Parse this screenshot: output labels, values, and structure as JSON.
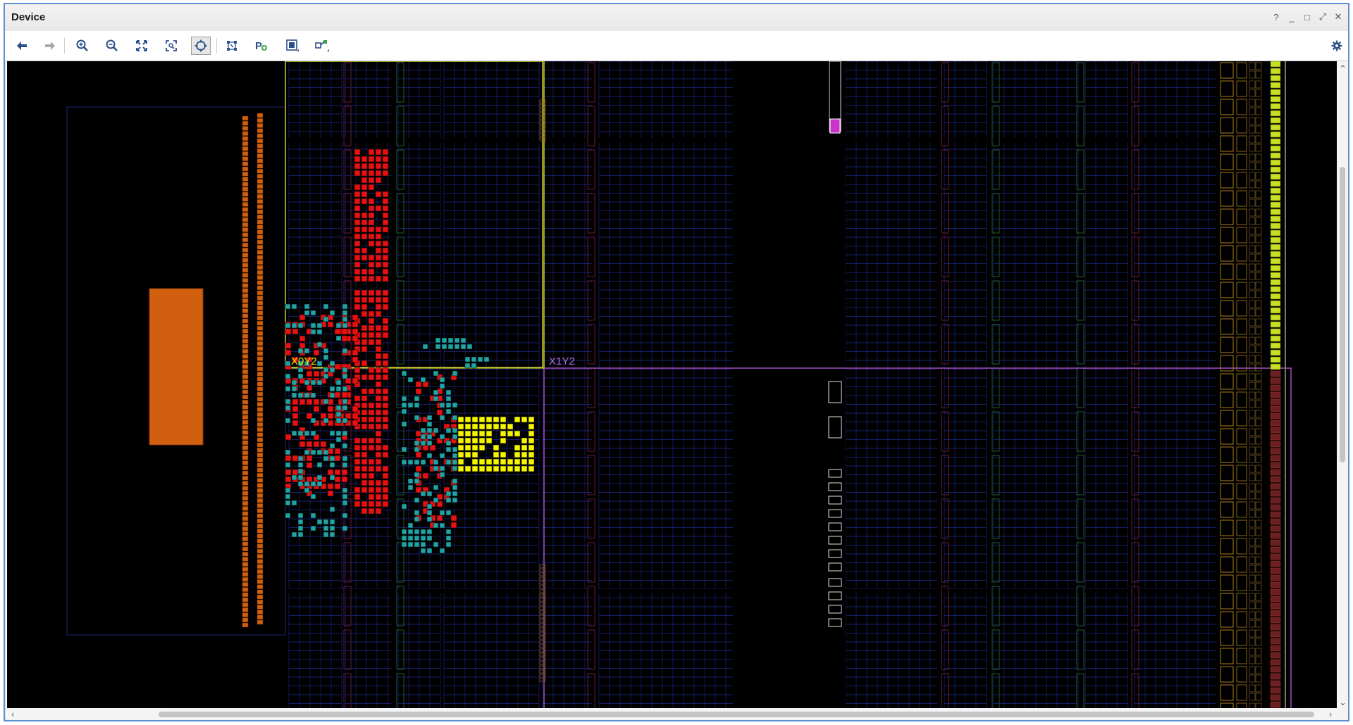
{
  "window": {
    "title": "Device",
    "controls": [
      "?",
      "_",
      "□",
      "⤢",
      "✕"
    ]
  },
  "toolbar": {
    "buttons": [
      {
        "name": "back",
        "icon": "arrow-left-icon"
      },
      {
        "name": "forward",
        "icon": "arrow-right-icon"
      },
      {
        "name": "zoom-in",
        "icon": "zoom-in-icon"
      },
      {
        "name": "zoom-out",
        "icon": "zoom-out-icon"
      },
      {
        "name": "zoom-fit",
        "icon": "expand-icon"
      },
      {
        "name": "zoom-area",
        "icon": "zoom-area-icon"
      },
      {
        "name": "auto-fit-selection",
        "icon": "crosshair-icon",
        "active": true
      },
      {
        "name": "routing-resources",
        "icon": "routing-icon"
      },
      {
        "name": "add-pblock",
        "icon": "add-pblock-icon"
      },
      {
        "name": "device-view-options",
        "icon": "layers-icon"
      },
      {
        "name": "show-connections",
        "icon": "connections-icon"
      },
      {
        "name": "settings",
        "icon": "gear-icon"
      }
    ]
  },
  "device_view": {
    "clock_regions": [
      {
        "label": "X0Y2",
        "color": "#e6e600"
      },
      {
        "label": "X1Y2",
        "color": "#b070e0"
      }
    ],
    "colors": {
      "background": "#000000",
      "grid": "#1e2a8a",
      "cell_red": "#e81010",
      "cell_teal": "#1fa3a3",
      "cell_yellow": "#f5f500",
      "io_orange": "#d0600f",
      "pblock_yellow": "#c8c832",
      "pblock_purple": "#a050c0",
      "magenta": "#cc33cc"
    }
  }
}
